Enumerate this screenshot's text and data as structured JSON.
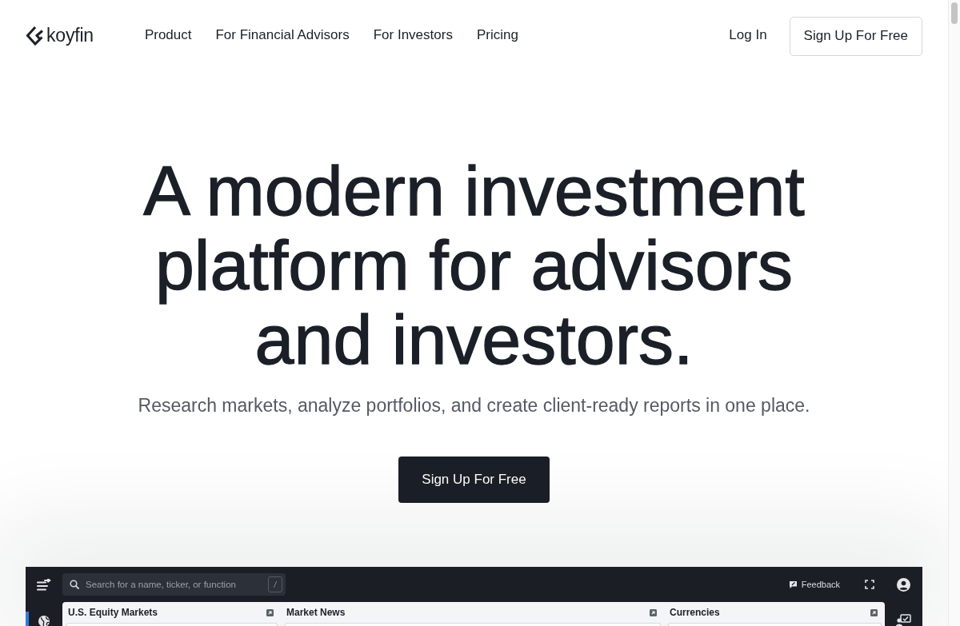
{
  "nav": {
    "logo": "koyfin",
    "links": [
      "Product",
      "For Financial Advisors",
      "For Investors",
      "Pricing"
    ],
    "login": "Log In",
    "signup": "Sign Up For Free"
  },
  "hero": {
    "heading": "A modern investment platform for advisors and investors.",
    "subheading": "Research markets, analyze portfolios, and create client-ready reports in one place.",
    "cta": "Sign Up For Free"
  },
  "app_preview": {
    "search": {
      "placeholder": "Search for a name, ticker, or function",
      "shortcut": "/"
    },
    "feedback": "Feedback",
    "left_rail": [
      {
        "selected": true
      }
    ],
    "widgets": [
      {
        "title": "U.S. Equity Markets"
      },
      {
        "title": "Market News"
      },
      {
        "title": "Currencies"
      }
    ]
  }
}
